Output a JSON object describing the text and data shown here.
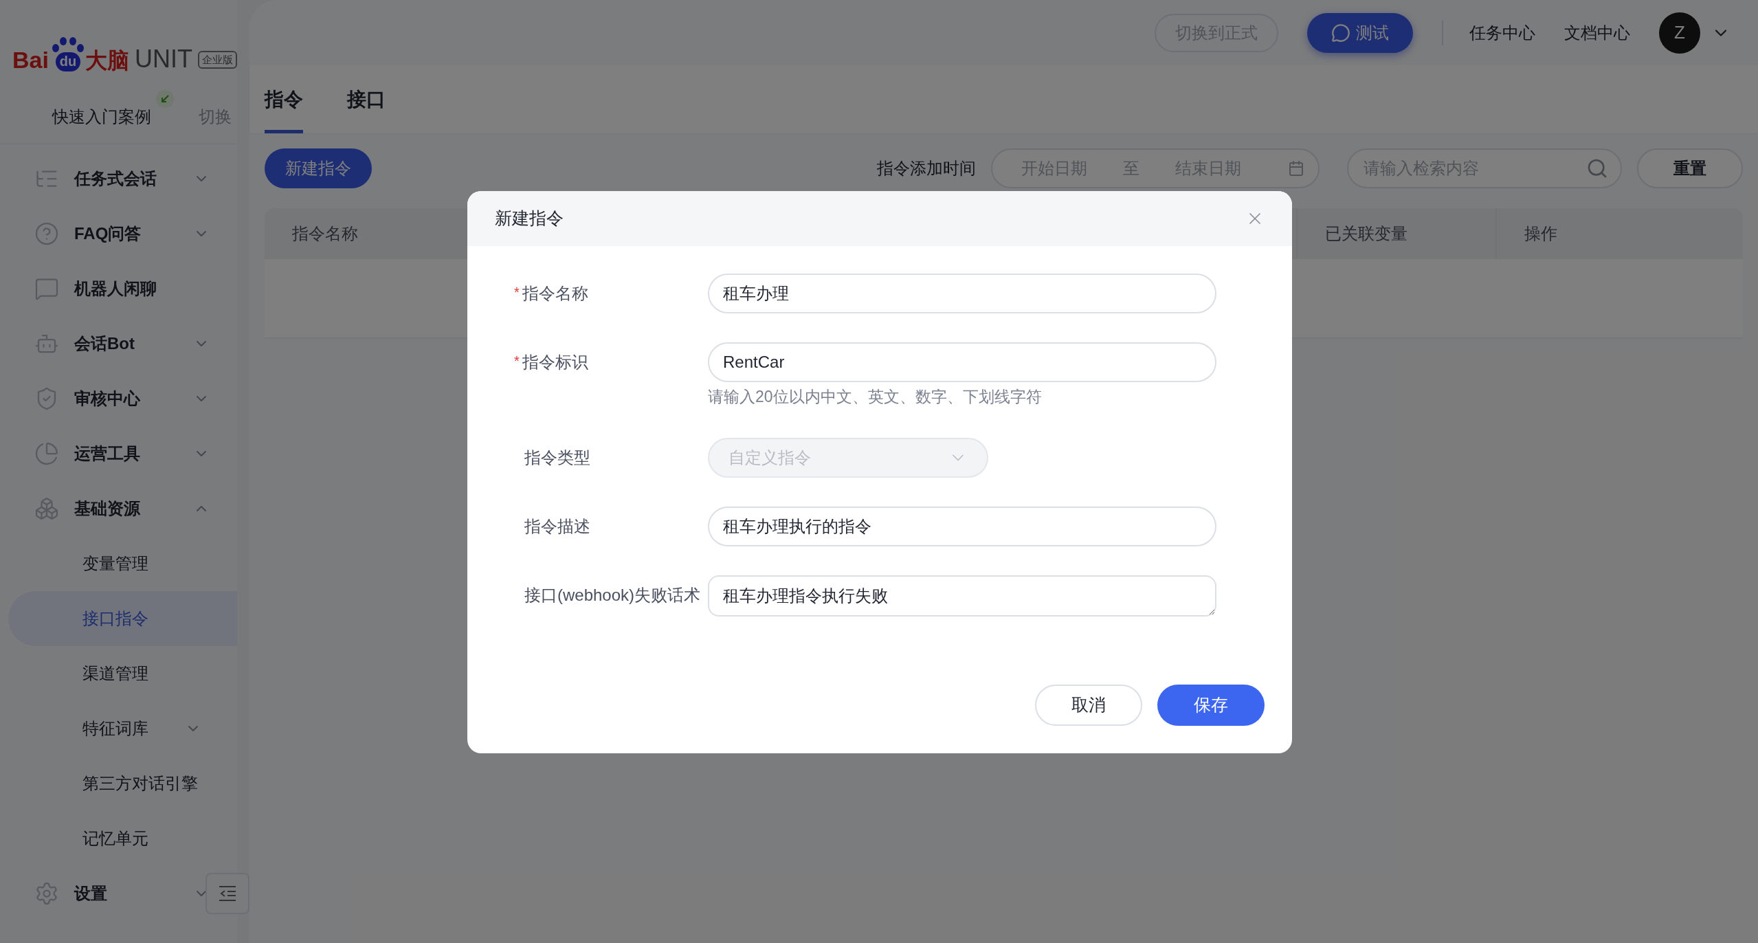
{
  "logo": {
    "brand": "Bai",
    "paw_text": "du",
    "brand_cn": "大脑",
    "product": "UNIT",
    "edition": "企业版"
  },
  "quick_start": {
    "label": "快速入门案例",
    "switch": "切换"
  },
  "sidebar": {
    "items": [
      {
        "label": "任务式会话",
        "expanded": false
      },
      {
        "label": "FAQ问答",
        "expanded": false
      },
      {
        "label": "机器人闲聊"
      },
      {
        "label": "会话Bot",
        "expanded": false
      },
      {
        "label": "审核中心",
        "expanded": false
      },
      {
        "label": "运营工具",
        "expanded": false
      },
      {
        "label": "基础资源",
        "expanded": true,
        "children": [
          {
            "label": "变量管理",
            "selected": false
          },
          {
            "label": "接口指令",
            "selected": true
          },
          {
            "label": "渠道管理",
            "selected": false
          },
          {
            "label": "特征词库",
            "selected": false,
            "expanded": false
          },
          {
            "label": "第三方对话引擎",
            "selected": false
          },
          {
            "label": "记忆单元",
            "selected": false
          }
        ]
      },
      {
        "label": "设置",
        "expanded": false
      }
    ]
  },
  "header": {
    "switch_button": "切换到正式",
    "test_button": "测试",
    "links": [
      "任务中心",
      "文档中心"
    ],
    "avatar": "Z"
  },
  "tabs": [
    {
      "label": "指令",
      "selected": true
    },
    {
      "label": "接口",
      "selected": false
    }
  ],
  "toolbar": {
    "new_button": "新建指令",
    "date_label": "指令添加时间",
    "start_placeholder": "开始日期",
    "separator": "至",
    "end_placeholder": "结束日期",
    "search_placeholder": "请输入检索内容",
    "reset_button": "重置"
  },
  "table": {
    "columns": [
      "指令名称",
      "已关联变量",
      "操作"
    ]
  },
  "modal": {
    "title": "新建指令",
    "fields": [
      {
        "label": "指令名称",
        "required_mark": "*",
        "kind": "input",
        "value": "租车办理"
      },
      {
        "label": "指令标识",
        "required_mark": "*",
        "kind": "input",
        "value": "RentCar",
        "hint": "请输入20位以内中文、英文、数字、下划线字符"
      },
      {
        "label": "指令类型",
        "kind": "select",
        "value": "自定义指令",
        "disabled": true
      },
      {
        "label": "指令描述",
        "kind": "input",
        "value": "租车办理执行的指令"
      },
      {
        "label": "接口(webhook)失败话术",
        "kind": "textarea",
        "value": "租车办理指令执行失败"
      }
    ],
    "buttons": [
      {
        "label": "取消",
        "kind": "secondary"
      },
      {
        "label": "保存",
        "kind": "primary"
      }
    ]
  }
}
